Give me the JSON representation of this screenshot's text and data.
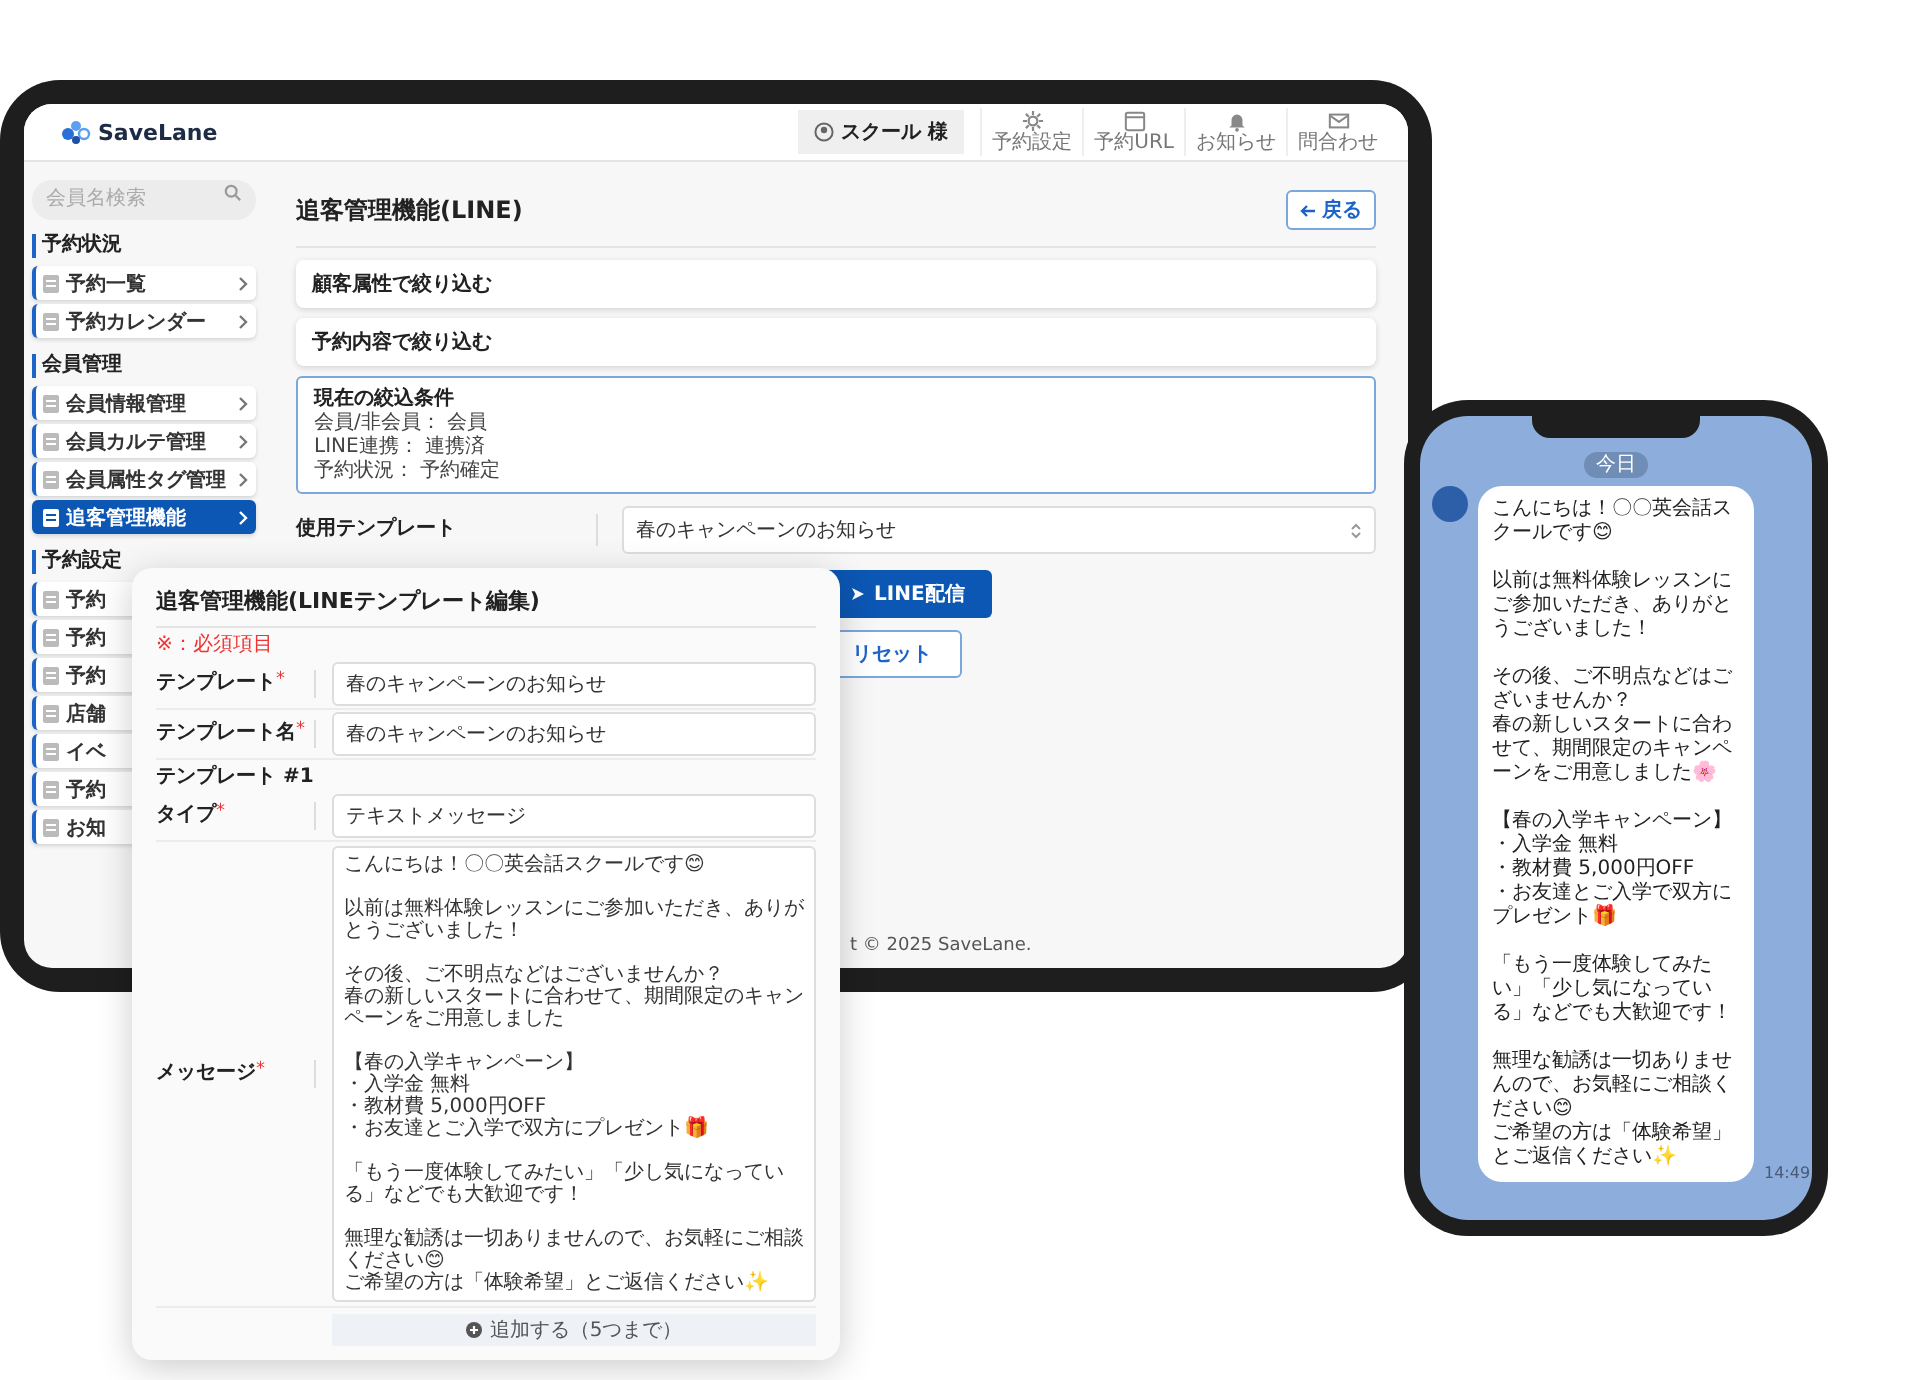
{
  "tablet": {
    "header": {
      "logo": "SaveLane",
      "user": "スクール 様",
      "actions": [
        "予約設定",
        "予約URL",
        "お知らせ",
        "問合わせ"
      ]
    },
    "sidebar": {
      "search": {
        "placeholder": "会員名検索"
      },
      "sections": [
        {
          "title": "予約状況",
          "items": [
            {
              "label": "予約一覧",
              "selected": false
            },
            {
              "label": "予約カレンダー",
              "selected": false
            }
          ]
        },
        {
          "title": "会員管理",
          "items": [
            {
              "label": "会員情報管理",
              "selected": false
            },
            {
              "label": "会員カルテ管理",
              "selected": false
            },
            {
              "label": "会員属性タグ管理",
              "selected": false
            },
            {
              "label": "追客管理機能",
              "selected": true
            }
          ]
        },
        {
          "title": "予約設定",
          "items": [
            {
              "label": "予約",
              "selected": false
            },
            {
              "label": "予約",
              "selected": false
            },
            {
              "label": "予約",
              "selected": false
            },
            {
              "label": "店舗",
              "selected": false
            },
            {
              "label": "イベ",
              "selected": false
            },
            {
              "label": "予約",
              "selected": false
            },
            {
              "label": "お知",
              "selected": false
            }
          ]
        }
      ]
    },
    "main": {
      "title": "追客管理機能(LINE)",
      "back_button": "戻る",
      "filters": [
        "顧客属性で絞り込む",
        "予約内容で絞り込む"
      ],
      "conditions": {
        "title": "現在の絞込条件",
        "lines": [
          "会員/非会員： 会員",
          "LINE連携： 連携済",
          "予約状況： 予約確定"
        ]
      },
      "template": {
        "label": "使用テンプレート",
        "value": "春のキャンペーンのお知らせ"
      },
      "buttons": [
        {
          "label": "LINE配信",
          "kind": "primary"
        },
        {
          "label": "リセット",
          "kind": "secondary"
        }
      ],
      "footer": "t © 2025 SaveLane."
    }
  },
  "modal": {
    "title": "追客管理機能(LINEテンプレート編集)",
    "required_note": "※：必須項目",
    "fields": [
      {
        "label": "テンプレート",
        "mark": "*",
        "kind": "input",
        "value": "春のキャンペーンのお知らせ"
      },
      {
        "label": "テンプレート名",
        "mark": "*",
        "kind": "input",
        "value": "春のキャンペーンのお知らせ"
      }
    ],
    "section": "テンプレート #1",
    "section_fields": [
      {
        "label": "タイプ",
        "mark": "*",
        "kind": "input",
        "value": "テキストメッセージ"
      },
      {
        "label": "メッセージ",
        "mark": "*",
        "kind": "textarea",
        "paragraphs": [
          [
            "こんにちは！〇〇英会話スクールです😊"
          ],
          [
            "以前は無料体験レッスンにご参加いただき、ありがとうございました！"
          ],
          [
            "その後、ご不明点などはございませんか？",
            "春の新しいスタートに合わせて、期間限定のキャンペーンをご用意しました"
          ],
          [
            "【春の入学キャンペーン】",
            "・入学金 無料",
            "・教材費 5,000円OFF",
            "・お友達とご入学で双方にプレゼント🎁"
          ],
          [
            "「もう一度体験してみたい」「少し気になっている」などでも大歓迎です！"
          ],
          [
            "無理な勧誘は一切ありませんので、お気軽にご相談ください😊",
            "ご希望の方は「体験希望」とご返信ください✨"
          ]
        ]
      }
    ],
    "add_button": "追加する（5つまで）"
  },
  "phone": {
    "date": "今日",
    "paragraphs": [
      [
        "こんにちは！〇〇英会話スクールです😊"
      ],
      [
        "以前は無料体験レッスンにご参加いただき、ありがとうございました！"
      ],
      [
        "その後、ご不明点などはございませんか？",
        "春の新しいスタートに合わせて、期間限定のキャンペーンをご用意しました🌸"
      ],
      [
        "【春の入学キャンペーン】",
        "・入学金 無料",
        "・教材費 5,000円OFF",
        "・お友達とご入学で双方にプレゼント🎁"
      ],
      [
        "「もう一度体験してみたい」「少し気になっている」などでも大歓迎です！"
      ],
      [
        "無理な勧誘は一切ありませんので、お気軽にご相談ください😊",
        "ご希望の方は「体験希望」とご返信ください✨"
      ]
    ],
    "time": "14:49"
  }
}
